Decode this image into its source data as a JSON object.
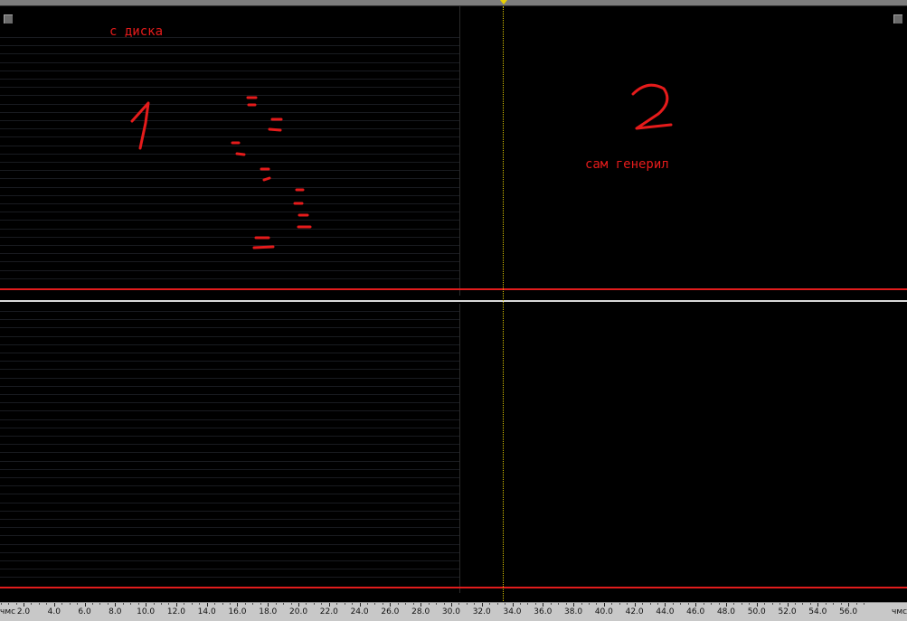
{
  "annotations": {
    "from_disk": "с диска",
    "self_generated": "сам генерил",
    "marker_one": "1",
    "marker_two": "2"
  },
  "ruler": {
    "unit_left": "чмс",
    "unit_right": "чмс",
    "ticks": [
      "2.0",
      "4.0",
      "6.0",
      "8.0",
      "10.0",
      "12.0",
      "14.0",
      "16.0",
      "18.0",
      "20.0",
      "22.0",
      "24.0",
      "26.0",
      "28.0",
      "30.0",
      "32.0",
      "34.0",
      "36.0",
      "38.0",
      "40.0",
      "42.0",
      "44.0",
      "46.0",
      "48.0",
      "50.0",
      "52.0",
      "54.0",
      "56.0"
    ]
  },
  "colors": {
    "background": "#000000",
    "zero_line": "#e11c1c",
    "annotation": "#e51b1b",
    "cursor": "#d8c200",
    "channel_divider": "#d8d8d8",
    "ruler": "#c8c8c8"
  },
  "icons": {
    "playhead": "playhead-marker-icon",
    "corner": "resize-corner-icon"
  }
}
